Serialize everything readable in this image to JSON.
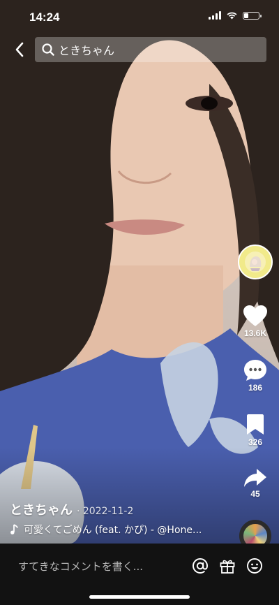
{
  "status_bar": {
    "time": "14:24",
    "battery_level": 0.3
  },
  "search": {
    "query": "ときちゃん"
  },
  "actions": {
    "like_count": "13.6K",
    "comment_count": "186",
    "bookmark_count": "326",
    "share_count": "45"
  },
  "caption": {
    "author": "ときちゃん",
    "date": "· 2022-11-2",
    "music": "可愛くてごめん (feat. かぴ) - @Hone..."
  },
  "comment_bar": {
    "placeholder": "すてきなコメントを書く..."
  },
  "icons": [
    "back-arrow-icon",
    "search-icon",
    "heart-icon",
    "comment-icon",
    "bookmark-icon",
    "share-icon",
    "music-note-icon",
    "at-icon",
    "gift-icon",
    "emoji-icon"
  ],
  "colors": {
    "comment_bar_bg": "#121212",
    "shirt": "#4a5fae",
    "avatar_bg": "#f1ea8a"
  }
}
